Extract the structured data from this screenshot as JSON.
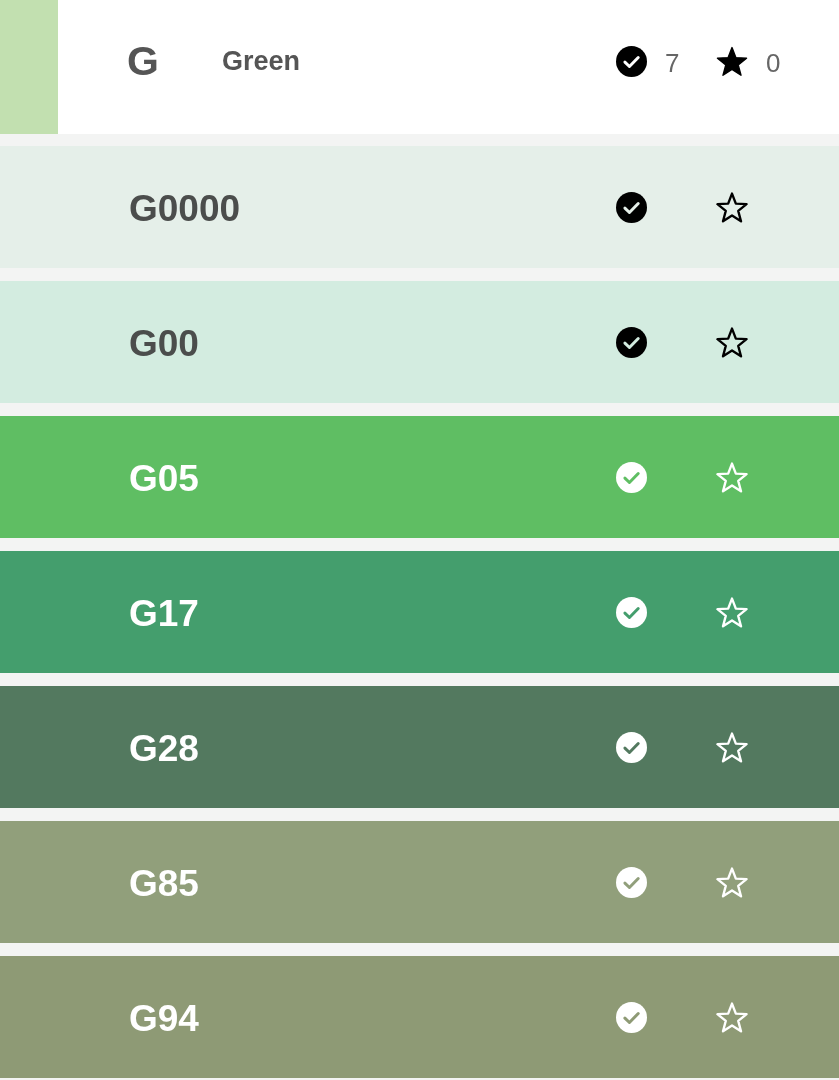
{
  "header": {
    "letter": "G",
    "name": "Green",
    "color": "#c2e0b0",
    "checked_count": "7",
    "starred_count": "0"
  },
  "rows": [
    {
      "code": "G0000",
      "color": "#e5efe9",
      "checked": true,
      "starred": false
    },
    {
      "code": "G00",
      "color": "#d3ece0",
      "checked": true,
      "starred": false
    },
    {
      "code": "G05",
      "color": "#5fbe63",
      "checked": true,
      "starred": false
    },
    {
      "code": "G17",
      "color": "#449e6d",
      "checked": true,
      "starred": false
    },
    {
      "code": "G28",
      "color": "#53795f",
      "checked": true,
      "starred": false
    },
    {
      "code": "G85",
      "color": "#919f7b",
      "checked": true,
      "starred": false
    },
    {
      "code": "G94",
      "color": "#8e9a75",
      "checked": true,
      "starred": false
    }
  ]
}
